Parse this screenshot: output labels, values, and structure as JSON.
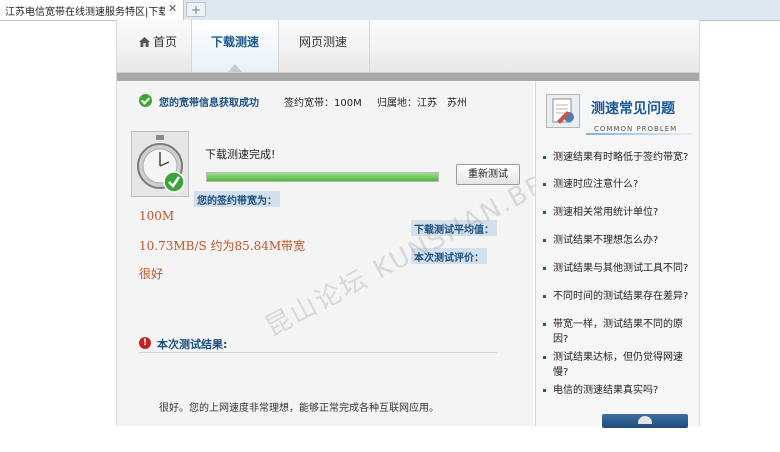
{
  "browser": {
    "tab_title": "江苏电信宽带在线测速服务特区|下载",
    "close_icon": "close-icon",
    "newtab_icon": "plus-icon"
  },
  "nav": {
    "home": "首页",
    "download_test": "下载测速",
    "web_test": "网页测速"
  },
  "info": {
    "title": "您的宽带信息获取成功",
    "bandwidth": "签约宽带：100M",
    "location": "归属地：江苏　苏州"
  },
  "test": {
    "done_title": "下载测速完成!",
    "progress": 1.0,
    "retest_label": "重新测试",
    "contract_label": "您的签约带宽为：",
    "contract_value": "100M",
    "avg_label": "下载测试平均值：",
    "avg_value": "10.73MB/S 约为85.84M带宽",
    "eval_label": "本次测试评价：",
    "eval_value": "很好",
    "watermark": "昆山论坛 KUNSHAN.BBS"
  },
  "result": {
    "title": "本次测试结果:",
    "text": "很好。您的上网速度非常理想，能够正常完成各种互联网应用。"
  },
  "faq": {
    "title": "测速常见问题",
    "subtitle": "COMMON PROBLEM",
    "items": [
      "测速结果有时略低于签约带宽?",
      "测速时应注意什么?",
      "测速相关常用统计单位?",
      "测试结果不理想怎么办?",
      "测试结果与其他测试工具不同?",
      "不同时间的测试结果存在差异?",
      "带宽一样，测试结果不同的原因?",
      "测试结果达标，但仍觉得网速慢?",
      "电信的测速结果真实吗?"
    ]
  },
  "colors": {
    "accent": "#1c4f7e",
    "value_text": "#c0562a",
    "progress_fill": "#4fb33a"
  }
}
